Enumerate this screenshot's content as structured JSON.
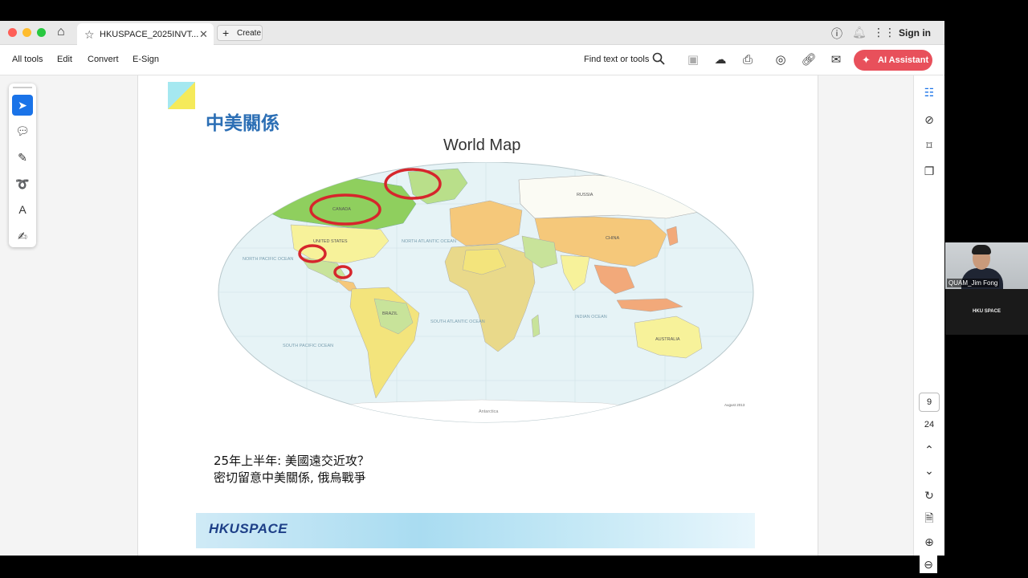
{
  "tab": {
    "title": "HKUSPACE_2025INVT...",
    "create_label": "Create"
  },
  "header": {
    "sign_in": "Sign in"
  },
  "toolbar": {
    "menu": [
      "All tools",
      "Edit",
      "Convert",
      "E-Sign"
    ],
    "find_label": "Find text or tools",
    "ai_label": "AI Assistant"
  },
  "page": {
    "title": "中美關係",
    "map_title": "World Map",
    "caption_line1": "25年上半年: 美國遠交近攻？",
    "caption_line2": "密切留意中美關係, 俄烏戰爭",
    "banner_logo": "HKUSPACE"
  },
  "map_labels": {
    "canada": "CANADA",
    "united_states": "UNITED STATES",
    "brazil": "BRAZIL",
    "russia": "RUSSIA",
    "china": "CHINA",
    "australia": "AUSTRALIA",
    "north_pacific": "NORTH PACIFIC OCEAN",
    "south_pacific": "SOUTH PACIFIC OCEAN",
    "atlantic": "NORTH ATLANTIC OCEAN",
    "south_atlantic": "SOUTH ATLANTIC OCEAN",
    "indian": "INDIAN OCEAN",
    "antarctica": "Antarctica",
    "date": "August 2013"
  },
  "pagination": {
    "current": "9",
    "total": "24"
  },
  "video": {
    "participant": "QUAM_Jim Fong",
    "org": "HKU SPACE"
  },
  "colors": {
    "accent": "#e8505b",
    "title_blue": "#2c6fb5",
    "select_blue": "#1a73e8"
  }
}
